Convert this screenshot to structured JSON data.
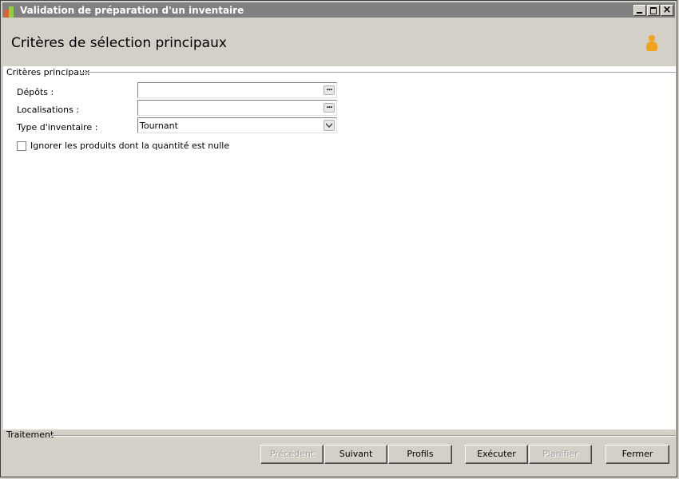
{
  "window": {
    "title": "Validation de préparation d'un inventaire"
  },
  "header": {
    "title": "Critères de sélection principaux",
    "user_icon": "user-icon"
  },
  "criteria": {
    "group_label": "Critères principaux",
    "fields": [
      {
        "label": "Dépôts :",
        "value": "",
        "button": "..."
      },
      {
        "label": "Localisations :",
        "value": "",
        "button": "..."
      },
      {
        "label": "Type d'inventaire :",
        "value": "Tournant"
      }
    ],
    "checkbox": {
      "label": "Ignorer les produits dont la quantité est nulle",
      "checked": false
    }
  },
  "footer": {
    "group_label": "Traitement",
    "buttons": [
      {
        "label": "Précédent",
        "enabled": false
      },
      {
        "label": "Suivant",
        "enabled": true
      },
      {
        "label": "Profils",
        "enabled": true
      },
      {
        "label": "Exécuter",
        "enabled": true
      },
      {
        "label": "Planifier",
        "enabled": false
      },
      {
        "label": "Fermer",
        "enabled": true
      }
    ]
  },
  "colors": {
    "window_bg": "#d4d0c8",
    "titlebar": "#808080",
    "user_icon": "#f3a21b"
  }
}
